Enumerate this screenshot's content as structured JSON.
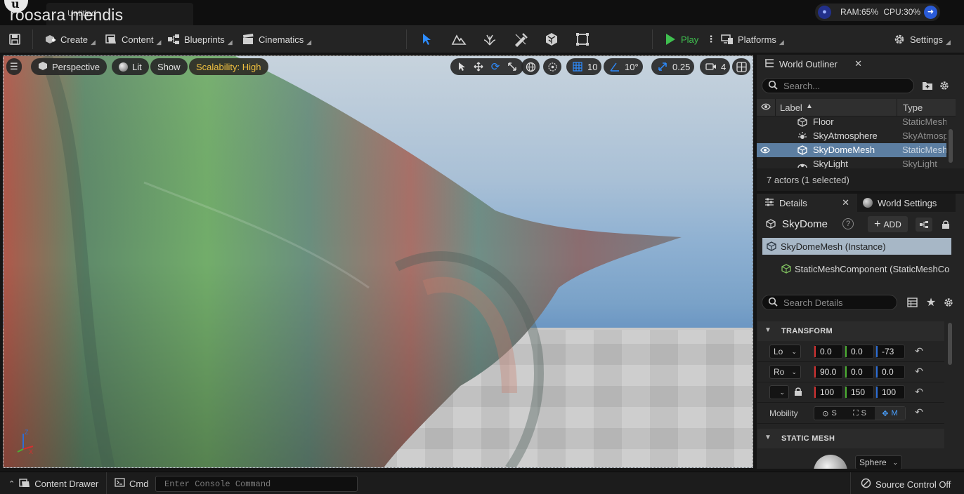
{
  "title_bar": {
    "document_tab": "Untitled",
    "overlay_name": "roosara mendis",
    "perf": {
      "ram_label": "RAM:",
      "ram_value": "65%",
      "cpu_label": "CPU:",
      "cpu_value": "30%"
    }
  },
  "toolbar": {
    "create": "Create",
    "content": "Content",
    "blueprints": "Blueprints",
    "cinematics": "Cinematics",
    "play": "Play",
    "platforms": "Platforms",
    "settings": "Settings",
    "play_color": "#3fbf4f"
  },
  "viewport": {
    "perspective": "Perspective",
    "lit": "Lit",
    "show": "Show",
    "scalability": "Scalability: High",
    "grid_snap": "10",
    "rotation_snap": "10°",
    "scale_snap": "0.25",
    "camera_speed": "4",
    "axis": {
      "z": "Z",
      "x": "X"
    }
  },
  "world_outliner": {
    "tab": "World Outliner",
    "search_placeholder": "Search...",
    "columns": {
      "label": "Label",
      "type": "Type"
    },
    "rows": [
      {
        "label": "Floor",
        "type": "StaticMesh",
        "icon": "static-mesh-icon"
      },
      {
        "label": "SkyAtmosphere",
        "type": "SkyAtmosp",
        "icon": "sky-atmosphere-icon"
      },
      {
        "label": "SkyDomeMesh",
        "type": "StaticMesh",
        "icon": "static-mesh-icon"
      },
      {
        "label": "SkyLight",
        "type": "SkyLight",
        "icon": "sky-light-icon"
      }
    ],
    "status": "7 actors (1 selected)"
  },
  "details": {
    "tab": "Details",
    "world_settings_tab": "World Settings",
    "actor_name": "SkyDome",
    "add_label": "ADD",
    "components": [
      {
        "label": "SkyDomeMesh (Instance)"
      },
      {
        "label": "StaticMeshComponent (StaticMeshCo"
      }
    ],
    "search_placeholder": "Search Details",
    "transform": {
      "section": "TRANSFORM",
      "location": {
        "mode": "Lo",
        "x": "0.0",
        "y": "0.0",
        "z": "-73"
      },
      "rotation": {
        "mode": "Ro",
        "x": "90.0",
        "y": "0.0",
        "z": "0.0"
      },
      "scale": {
        "x": "100",
        "y": "150",
        "z": "100"
      },
      "mobility_label": "Mobility",
      "mobility": {
        "static": "S",
        "stationary": "S",
        "movable": "M"
      }
    },
    "static_mesh": {
      "section": "STATIC MESH",
      "value": "Sphere"
    }
  },
  "status_bar": {
    "content_drawer": "Content Drawer",
    "cmd": "Cmd",
    "console_placeholder": "Enter Console Command",
    "source_control": "Source Control Off"
  }
}
